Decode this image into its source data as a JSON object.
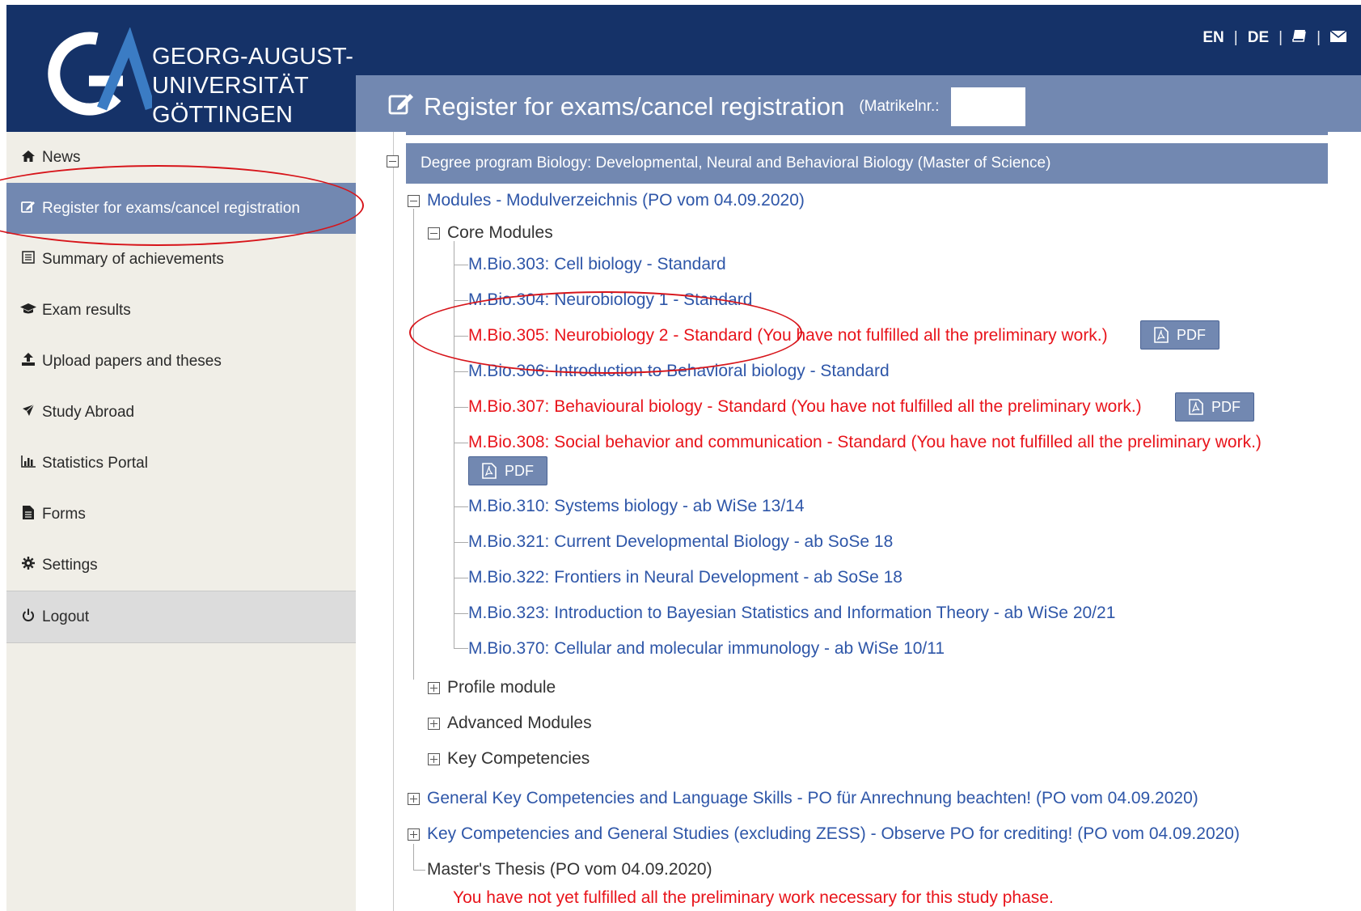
{
  "header": {
    "university_line1": "GEORG-AUGUST-UNIVERSITÄT",
    "university_line2": "GÖTTINGEN",
    "lang_en": "EN",
    "lang_de": "DE",
    "separator": "|",
    "page_title": "Register for exams/cancel registration",
    "matrikel_label": "(Matrikelnr.:"
  },
  "sidebar": {
    "items": [
      {
        "label": "News",
        "icon": "home-icon"
      },
      {
        "label": "Register for exams/cancel registration",
        "icon": "edit-icon"
      },
      {
        "label": "Summary of achievements",
        "icon": "list-icon"
      },
      {
        "label": "Exam results",
        "icon": "graduation-cap-icon"
      },
      {
        "label": "Upload papers and theses",
        "icon": "upload-icon"
      },
      {
        "label": "Study Abroad",
        "icon": "plane-icon"
      },
      {
        "label": "Statistics Portal",
        "icon": "bar-chart-icon"
      },
      {
        "label": "Forms",
        "icon": "file-icon"
      },
      {
        "label": "Settings",
        "icon": "gear-icon"
      },
      {
        "label": "Logout",
        "icon": "power-icon"
      }
    ]
  },
  "tree": {
    "degree": "Degree program Biology: Developmental, Neural and Behavioral Biology (Master of Science)",
    "modules_group": "Modules - Modulverzeichnis (PO vom 04.09.2020)",
    "core_modules": "Core Modules",
    "core_items": [
      "M.Bio.303: Cell biology - Standard",
      "M.Bio.304: Neurobiology 1 - Standard",
      "M.Bio.305: Neurobiology 2 - Standard (You have not fulfilled all the preliminary work.)",
      "M.Bio.306: Introduction to Behavioral biology - Standard",
      "M.Bio.307: Behavioural biology - Standard (You have not fulfilled all the preliminary work.)",
      "M.Bio.308: Social behavior and communication - Standard (You have not fulfilled all the preliminary work.)",
      "M.Bio.310: Systems biology - ab WiSe 13/14",
      "M.Bio.321: Current Developmental Biology - ab SoSe 18",
      "M.Bio.322: Frontiers in Neural Development - ab SoSe 18",
      "M.Bio.323: Introduction to Bayesian Statistics and Information Theory - ab WiSe 20/21",
      "M.Bio.370: Cellular and molecular immunology - ab WiSe 10/11"
    ],
    "pdf_label": "PDF",
    "profile_module": "Profile module",
    "advanced_modules": "Advanced Modules",
    "key_competencies": "Key Competencies",
    "general_key": "General Key Competencies and Language Skills - PO für Anrechnung beachten! (PO vom 04.09.2020)",
    "key_general_studies": "Key Competencies and General Studies (excluding ZESS) - Observe PO for crediting! (PO vom 04.09.2020)",
    "masters_thesis": "Master's Thesis (PO vom 04.09.2020)",
    "thesis_warning": "You have not yet fulfilled all the preliminary work necessary for this study phase."
  },
  "colors": {
    "header_blue": "#153268",
    "accent_blue": "#7288b1",
    "link_blue": "#2e56a8",
    "warning_red": "#e8141b",
    "annotation_red": "#d7141a"
  }
}
